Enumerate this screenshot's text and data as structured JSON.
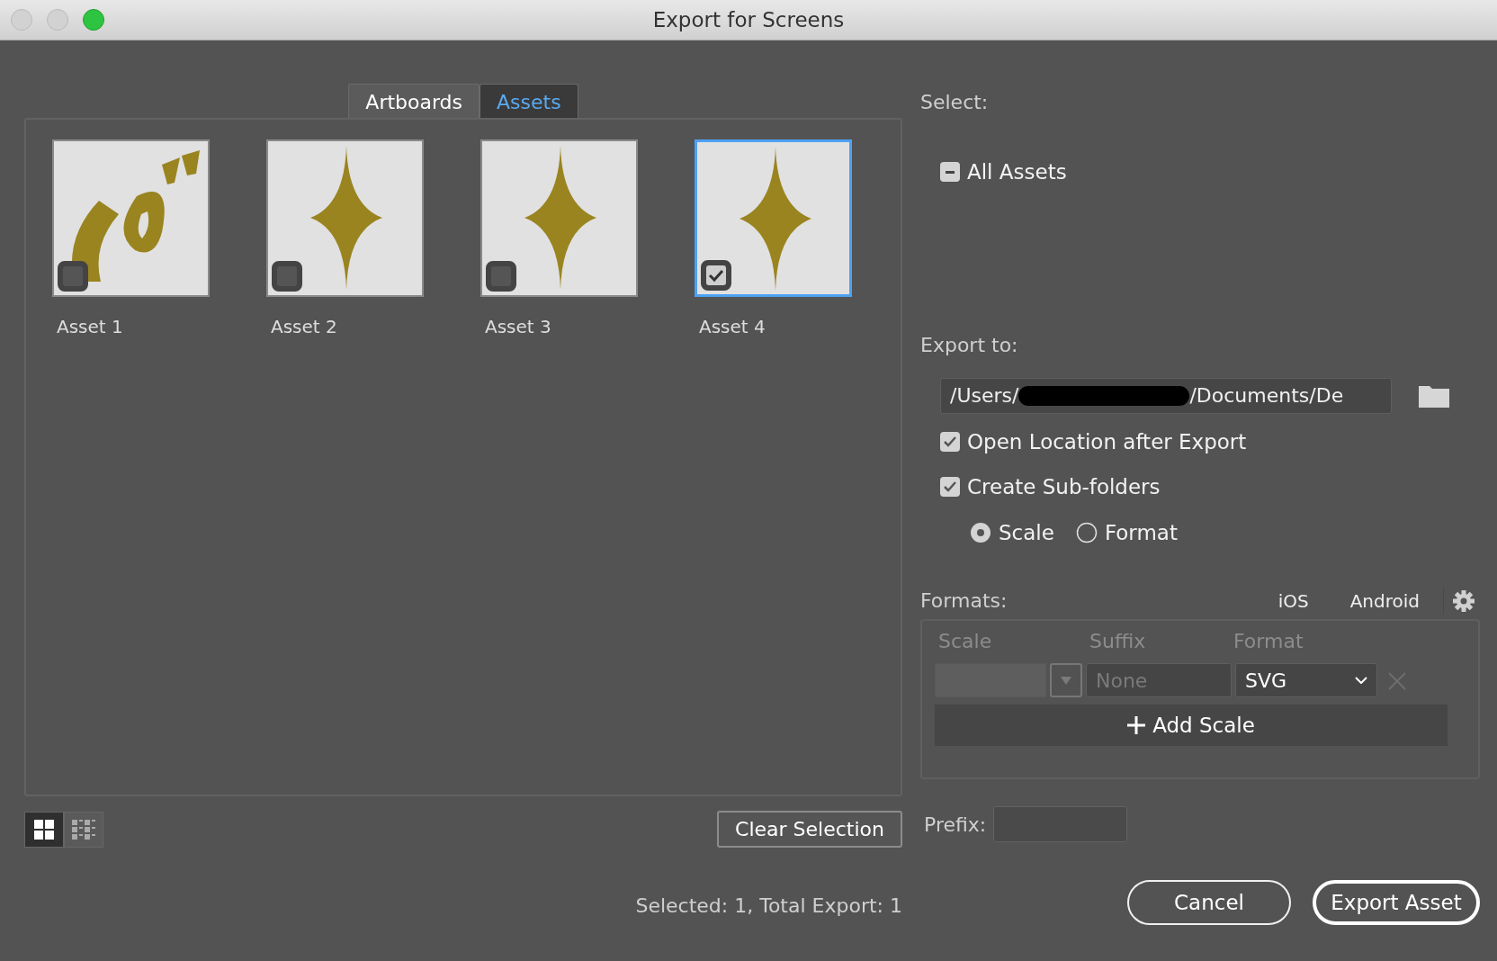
{
  "window": {
    "title": "Export for Screens"
  },
  "tabs": [
    {
      "label": "Artboards",
      "selected": false
    },
    {
      "label": "Assets",
      "selected": true
    }
  ],
  "assets": [
    {
      "label": "Asset 1",
      "kind": "badge",
      "checked": false,
      "selected": false
    },
    {
      "label": "Asset 2",
      "kind": "sparkle",
      "checked": false,
      "selected": false
    },
    {
      "label": "Asset 3",
      "kind": "sparkle",
      "checked": false,
      "selected": false
    },
    {
      "label": "Asset 4",
      "kind": "sparkle",
      "checked": true,
      "selected": true
    }
  ],
  "view_toggles": [
    {
      "kind": "grid",
      "selected": true
    },
    {
      "kind": "list",
      "selected": false
    }
  ],
  "clear_button": "Clear Selection",
  "status": "Selected: 1, Total Export: 1",
  "select": {
    "label": "Select:",
    "all": {
      "label": "All Assets",
      "mixed": true
    }
  },
  "export_to": {
    "label": "Export to:",
    "path_start": "/Users/",
    "path_end": "/Documents/De",
    "redacted": true
  },
  "options": [
    {
      "label": "Open Location after Export",
      "checked": true
    },
    {
      "label": "Create Sub-folders",
      "checked": true
    }
  ],
  "subfolder_by": [
    {
      "label": "Scale",
      "selected": true
    },
    {
      "label": "Format",
      "selected": false
    }
  ],
  "formats": {
    "label": "Formats:",
    "presets": [
      "iOS",
      "Android"
    ],
    "columns": [
      "Scale",
      "Suffix",
      "Format"
    ],
    "rows": [
      {
        "scale": "",
        "suffix_placeholder": "None",
        "format": "SVG"
      }
    ],
    "add_label": "Add Scale"
  },
  "prefix": {
    "label": "Prefix:"
  },
  "buttons": [
    {
      "label": "Cancel",
      "kind": "secondary"
    },
    {
      "label": "Export Asset",
      "kind": "primary"
    }
  ]
}
